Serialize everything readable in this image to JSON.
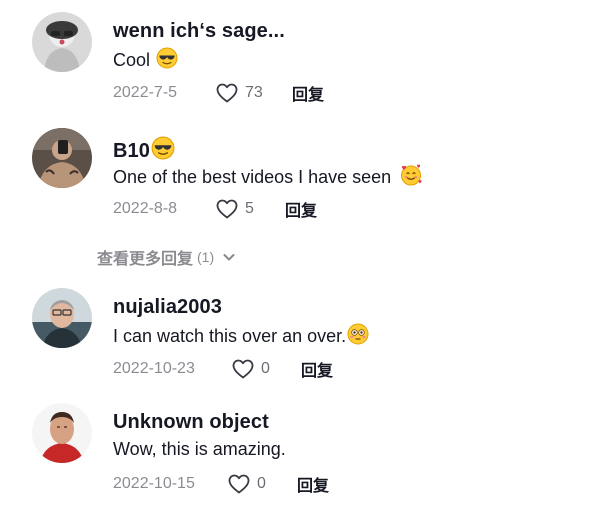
{
  "comments": [
    {
      "username": "wenn ich‘s sage...",
      "text": "Cool",
      "text_emoji": "sunglasses-emoji",
      "date": "2022-7-5",
      "likes": "73",
      "reply_label": "回复"
    },
    {
      "username": "B10",
      "username_emoji": "sunglasses-emoji",
      "text": "One of the best videos I have seen",
      "text_emoji": "smiling-face-with-hearts-emoji",
      "date": "2022-8-8",
      "likes": "5",
      "reply_label": "回复"
    },
    {
      "username": "nujalia2003",
      "text": "I can watch this over an over.",
      "text_emoji": "flushed-face-emoji",
      "date": "2022-10-23",
      "likes": "0",
      "reply_label": "回复"
    },
    {
      "username": "Unknown object",
      "text": "Wow, this is amazing.",
      "date": "2022-10-15",
      "likes": "0",
      "reply_label": "回复"
    }
  ],
  "view_more": {
    "label": "查看更多回复",
    "count": "(1)"
  },
  "colors": {
    "text": "#161823",
    "muted": "rgba(22,24,35,0.5)",
    "emoji": "#ffcc33"
  }
}
